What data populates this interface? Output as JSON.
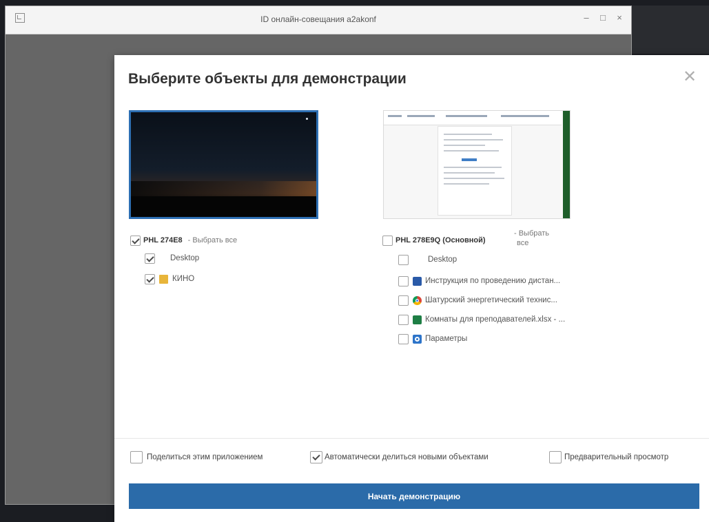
{
  "window": {
    "title": "ID онлайн-совещания a2akonf",
    "controls": [
      "–",
      "□",
      "×"
    ]
  },
  "dialog": {
    "title": "Выберите объекты для демонстрации",
    "close_icon": "close-icon",
    "monitors": [
      {
        "name": "PHL 274E8",
        "select_all": "- Выбрать все",
        "checked": true,
        "items": [
          {
            "label": "Desktop",
            "checked": true,
            "icon": ""
          },
          {
            "label": "КИНО",
            "checked": true,
            "icon": "folder-icon"
          }
        ]
      },
      {
        "name": "PHL 278E9Q (Основной)",
        "select_all_line1": "- Выбрать",
        "select_all_line2": "все",
        "checked": false,
        "items": [
          {
            "label": "Desktop",
            "checked": false,
            "icon": ""
          },
          {
            "label": "Инструкция по проведению дистан...",
            "checked": false,
            "icon": "word-icon"
          },
          {
            "label": "Шатурский энергетический технис...",
            "checked": false,
            "icon": "chrome-icon"
          },
          {
            "label": "Комнаты для преподавателей.xlsx - ...",
            "checked": false,
            "icon": "excel-icon"
          },
          {
            "label": "Параметры",
            "checked": false,
            "icon": "settings-icon"
          }
        ]
      }
    ],
    "options": {
      "share_app": {
        "label": "Поделиться этим приложением",
        "checked": false
      },
      "auto_share": {
        "label": "Автоматически делиться новыми объектами",
        "checked": true
      },
      "preview": {
        "label": "Предварительный просмотр",
        "checked": false
      }
    },
    "start_button": "Начать демонстрацию"
  },
  "colors": {
    "accent": "#2b6ba9",
    "selected_border": "#2d6fb3",
    "dialog_bg": "#ffffff",
    "backdrop": "#666666"
  }
}
